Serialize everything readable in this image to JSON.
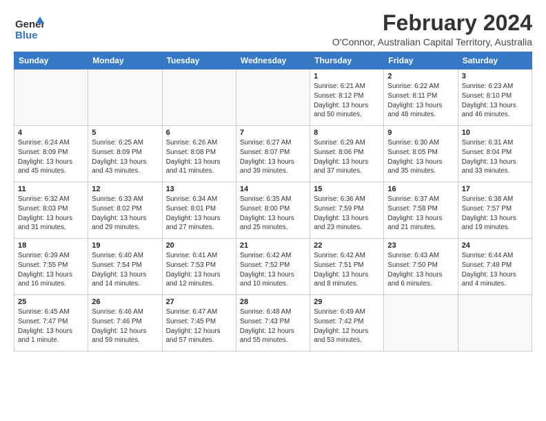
{
  "logo": {
    "line1": "General",
    "line2": "Blue",
    "icon_color": "#3578c5"
  },
  "title": "February 2024",
  "subtitle": "O'Connor, Australian Capital Territory, Australia",
  "headers": [
    "Sunday",
    "Monday",
    "Tuesday",
    "Wednesday",
    "Thursday",
    "Friday",
    "Saturday"
  ],
  "weeks": [
    [
      {
        "num": "",
        "info": ""
      },
      {
        "num": "",
        "info": ""
      },
      {
        "num": "",
        "info": ""
      },
      {
        "num": "",
        "info": ""
      },
      {
        "num": "1",
        "info": "Sunrise: 6:21 AM\nSunset: 8:12 PM\nDaylight: 13 hours\nand 50 minutes."
      },
      {
        "num": "2",
        "info": "Sunrise: 6:22 AM\nSunset: 8:11 PM\nDaylight: 13 hours\nand 48 minutes."
      },
      {
        "num": "3",
        "info": "Sunrise: 6:23 AM\nSunset: 8:10 PM\nDaylight: 13 hours\nand 46 minutes."
      }
    ],
    [
      {
        "num": "4",
        "info": "Sunrise: 6:24 AM\nSunset: 8:09 PM\nDaylight: 13 hours\nand 45 minutes."
      },
      {
        "num": "5",
        "info": "Sunrise: 6:25 AM\nSunset: 8:09 PM\nDaylight: 13 hours\nand 43 minutes."
      },
      {
        "num": "6",
        "info": "Sunrise: 6:26 AM\nSunset: 8:08 PM\nDaylight: 13 hours\nand 41 minutes."
      },
      {
        "num": "7",
        "info": "Sunrise: 6:27 AM\nSunset: 8:07 PM\nDaylight: 13 hours\nand 39 minutes."
      },
      {
        "num": "8",
        "info": "Sunrise: 6:29 AM\nSunset: 8:06 PM\nDaylight: 13 hours\nand 37 minutes."
      },
      {
        "num": "9",
        "info": "Sunrise: 6:30 AM\nSunset: 8:05 PM\nDaylight: 13 hours\nand 35 minutes."
      },
      {
        "num": "10",
        "info": "Sunrise: 6:31 AM\nSunset: 8:04 PM\nDaylight: 13 hours\nand 33 minutes."
      }
    ],
    [
      {
        "num": "11",
        "info": "Sunrise: 6:32 AM\nSunset: 8:03 PM\nDaylight: 13 hours\nand 31 minutes."
      },
      {
        "num": "12",
        "info": "Sunrise: 6:33 AM\nSunset: 8:02 PM\nDaylight: 13 hours\nand 29 minutes."
      },
      {
        "num": "13",
        "info": "Sunrise: 6:34 AM\nSunset: 8:01 PM\nDaylight: 13 hours\nand 27 minutes."
      },
      {
        "num": "14",
        "info": "Sunrise: 6:35 AM\nSunset: 8:00 PM\nDaylight: 13 hours\nand 25 minutes."
      },
      {
        "num": "15",
        "info": "Sunrise: 6:36 AM\nSunset: 7:59 PM\nDaylight: 13 hours\nand 23 minutes."
      },
      {
        "num": "16",
        "info": "Sunrise: 6:37 AM\nSunset: 7:58 PM\nDaylight: 13 hours\nand 21 minutes."
      },
      {
        "num": "17",
        "info": "Sunrise: 6:38 AM\nSunset: 7:57 PM\nDaylight: 13 hours\nand 19 minutes."
      }
    ],
    [
      {
        "num": "18",
        "info": "Sunrise: 6:39 AM\nSunset: 7:55 PM\nDaylight: 13 hours\nand 16 minutes."
      },
      {
        "num": "19",
        "info": "Sunrise: 6:40 AM\nSunset: 7:54 PM\nDaylight: 13 hours\nand 14 minutes."
      },
      {
        "num": "20",
        "info": "Sunrise: 6:41 AM\nSunset: 7:53 PM\nDaylight: 13 hours\nand 12 minutes."
      },
      {
        "num": "21",
        "info": "Sunrise: 6:42 AM\nSunset: 7:52 PM\nDaylight: 13 hours\nand 10 minutes."
      },
      {
        "num": "22",
        "info": "Sunrise: 6:42 AM\nSunset: 7:51 PM\nDaylight: 13 hours\nand 8 minutes."
      },
      {
        "num": "23",
        "info": "Sunrise: 6:43 AM\nSunset: 7:50 PM\nDaylight: 13 hours\nand 6 minutes."
      },
      {
        "num": "24",
        "info": "Sunrise: 6:44 AM\nSunset: 7:48 PM\nDaylight: 13 hours\nand 4 minutes."
      }
    ],
    [
      {
        "num": "25",
        "info": "Sunrise: 6:45 AM\nSunset: 7:47 PM\nDaylight: 13 hours\nand 1 minute."
      },
      {
        "num": "26",
        "info": "Sunrise: 6:46 AM\nSunset: 7:46 PM\nDaylight: 12 hours\nand 59 minutes."
      },
      {
        "num": "27",
        "info": "Sunrise: 6:47 AM\nSunset: 7:45 PM\nDaylight: 12 hours\nand 57 minutes."
      },
      {
        "num": "28",
        "info": "Sunrise: 6:48 AM\nSunset: 7:43 PM\nDaylight: 12 hours\nand 55 minutes."
      },
      {
        "num": "29",
        "info": "Sunrise: 6:49 AM\nSunset: 7:42 PM\nDaylight: 12 hours\nand 53 minutes."
      },
      {
        "num": "",
        "info": ""
      },
      {
        "num": "",
        "info": ""
      }
    ]
  ]
}
